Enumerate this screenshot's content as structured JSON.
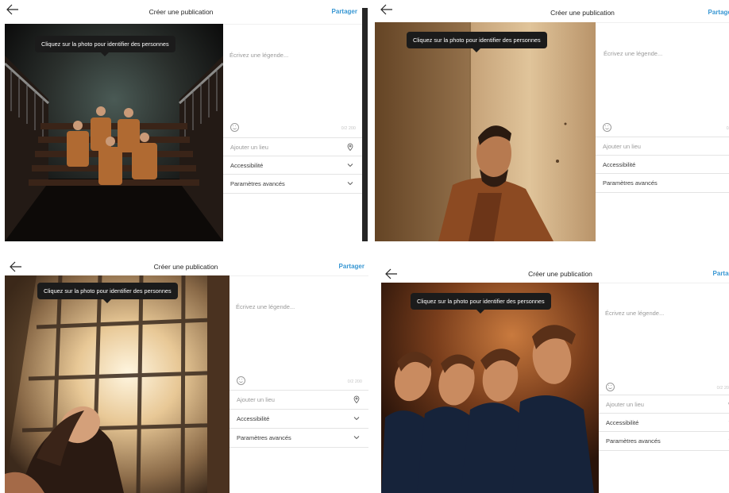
{
  "header": {
    "back_icon": "arrow-left-icon",
    "title": "Créer une publication",
    "share_label": "Partager",
    "share_color": "#3897d3"
  },
  "tooltip": "Cliquez sur la photo pour identifier des personnes",
  "caption_placeholder": "Écrivez une légende...",
  "emoji_icon": "smiley-icon",
  "char_count": "0/2 200",
  "options": [
    {
      "label": "Ajouter un lieu",
      "icon": "location-pin-icon"
    },
    {
      "label": "Accessibilité",
      "icon": "chevron-down-icon"
    },
    {
      "label": "Paramètres avancés",
      "icon": "chevron-down-icon"
    }
  ],
  "panels": [
    {
      "photo": "band-on-stairs"
    },
    {
      "photo": "man-against-wall"
    },
    {
      "photo": "woman-by-window"
    },
    {
      "photo": "four-men-leaning"
    }
  ]
}
